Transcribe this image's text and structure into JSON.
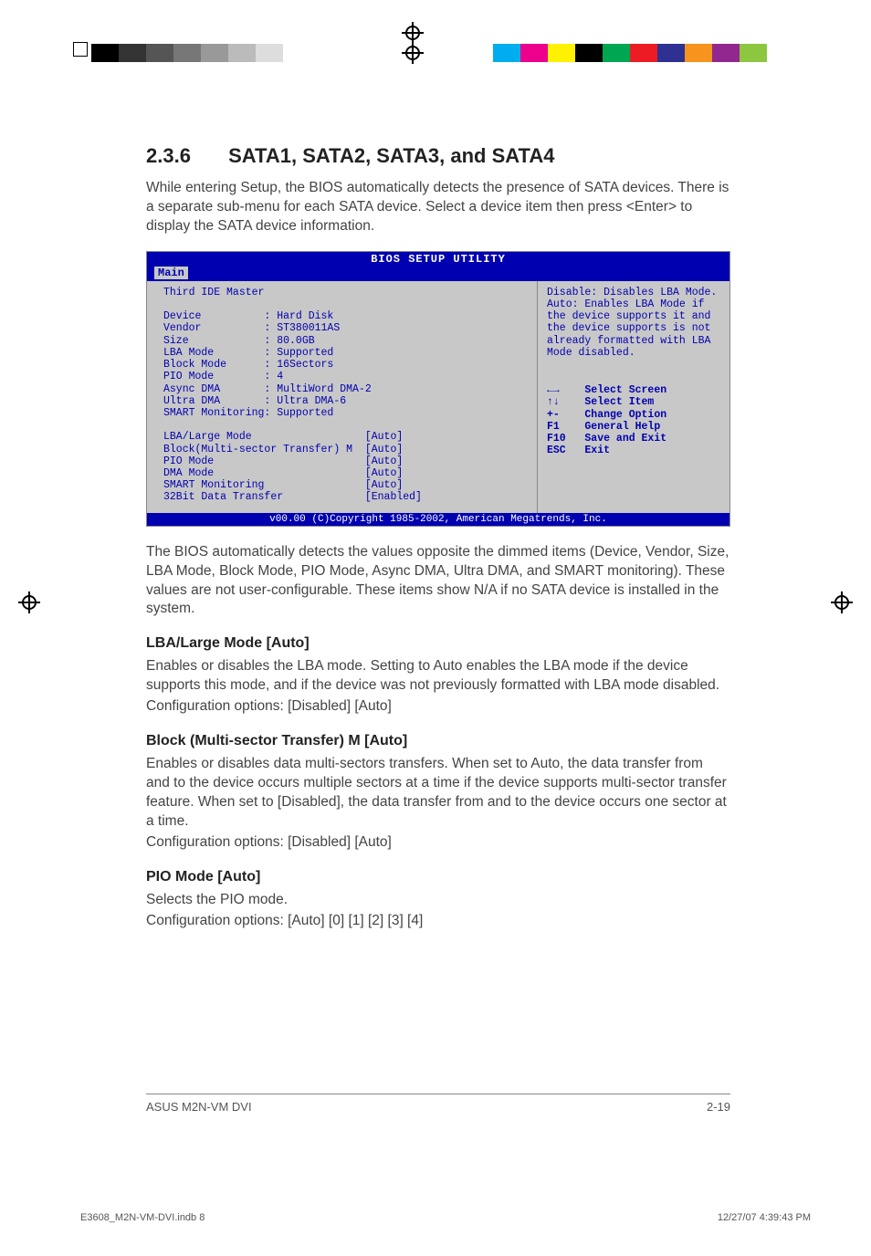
{
  "section": {
    "number": "2.3.6",
    "title": "SATA1, SATA2, SATA3, and SATA4",
    "intro": "While entering Setup, the BIOS automatically detects the presence of SATA devices. There is a separate sub-menu for each SATA device. Select a device item then press <Enter> to display the SATA device information."
  },
  "bios": {
    "title": "BIOS SETUP UTILITY",
    "tab": "Main",
    "heading": "Third IDE Master",
    "info_rows": [
      {
        "label": "Device",
        "value": "Hard Disk"
      },
      {
        "label": "Vendor",
        "value": "ST380011AS"
      },
      {
        "label": "Size",
        "value": "80.0GB"
      },
      {
        "label": "LBA Mode",
        "value": "Supported"
      },
      {
        "label": "Block Mode",
        "value": "16Sectors"
      },
      {
        "label": "PIO Mode",
        "value": "4"
      },
      {
        "label": "Async DMA",
        "value": "MultiWord DMA-2"
      },
      {
        "label": "Ultra DMA",
        "value": "Ultra DMA-6"
      },
      {
        "label": "SMART Monitoring",
        "value": "Supported"
      }
    ],
    "options": [
      {
        "label": "LBA/Large Mode",
        "value": "[Auto]"
      },
      {
        "label": "Block(Multi-sector Transfer) M",
        "value": "[Auto]"
      },
      {
        "label": "PIO Mode",
        "value": "[Auto]"
      },
      {
        "label": "DMA Mode",
        "value": "[Auto]"
      },
      {
        "label": "SMART Monitoring",
        "value": "[Auto]"
      },
      {
        "label": "32Bit Data Transfer",
        "value": "[Enabled]"
      }
    ],
    "help": "Disable: Disables LBA Mode.\nAuto: Enables LBA Mode if the device supports it and the device supports is not already formatted with LBA Mode disabled.",
    "nav": [
      {
        "key": "←→",
        "label": "Select Screen"
      },
      {
        "key": "↑↓",
        "label": "Select Item"
      },
      {
        "key": "+-",
        "label": "Change Option"
      },
      {
        "key": "F1",
        "label": "General Help"
      },
      {
        "key": "F10",
        "label": "Save and Exit"
      },
      {
        "key": "ESC",
        "label": "Exit"
      }
    ],
    "copyright": "v00.00 (C)Copyright 1985-2002, American Megatrends, Inc."
  },
  "body": {
    "detect_para": "The BIOS automatically detects the values opposite the dimmed items (Device, Vendor, Size, LBA Mode, Block Mode, PIO Mode, Async DMA, Ultra DMA, and SMART monitoring). These values are not user-configurable. These items show N/A if no SATA device is installed in the system.",
    "lba_heading": "LBA/Large Mode [Auto]",
    "lba_text": "Enables or disables the LBA mode. Setting to Auto enables the LBA mode if the device supports this mode, and if the device was not previously formatted with LBA mode disabled.",
    "lba_opts": "Configuration options: [Disabled] [Auto]",
    "block_heading": "Block (Multi-sector Transfer) M [Auto]",
    "block_text": "Enables or disables data multi-sectors transfers. When set to Auto, the data transfer from and to the device occurs multiple sectors at a time if the device supports multi-sector transfer feature. When set to [Disabled], the data transfer from and to the device occurs one sector at a time.",
    "block_opts": "Configuration options: [Disabled] [Auto]",
    "pio_heading": "PIO Mode [Auto]",
    "pio_text": "Selects the PIO mode.",
    "pio_opts": "Configuration options: [Auto] [0] [1] [2] [3] [4]"
  },
  "footer": {
    "product": "ASUS M2N-VM DVI",
    "page_num": "2-19"
  },
  "print": {
    "file": "E3608_M2N-VM-DVI.indb   8",
    "timestamp": "12/27/07   4:39:43 PM"
  },
  "marks": {
    "grays": [
      "#000",
      "#333",
      "#555",
      "#777",
      "#999",
      "#bbb",
      "#ddd",
      "#fff",
      "#fff"
    ],
    "colors": [
      "#00aeef",
      "#ec008c",
      "#fff200",
      "#000",
      "#00a651",
      "#ed1c24",
      "#2e3192",
      "#f7941d",
      "#92278f",
      "#8dc63f"
    ]
  }
}
